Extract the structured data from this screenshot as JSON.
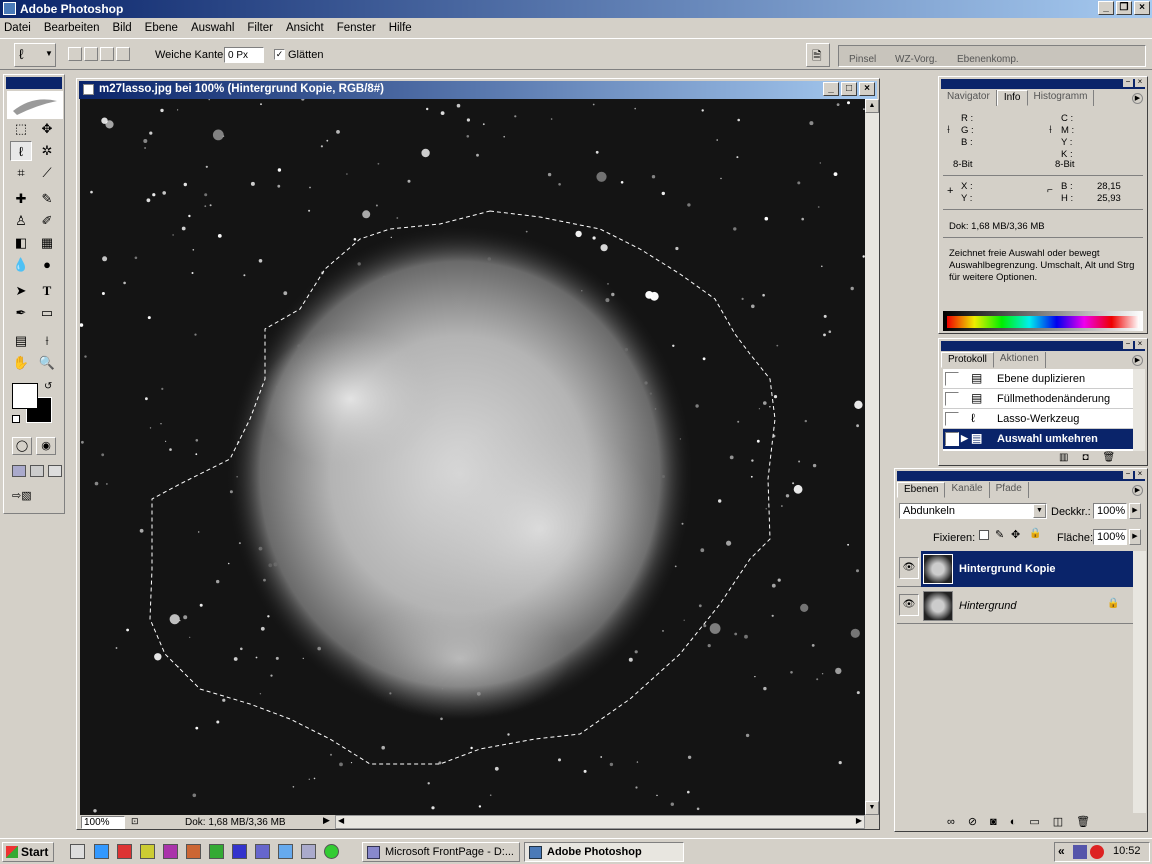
{
  "app": {
    "title": "Adobe Photoshop"
  },
  "menu": [
    "Datei",
    "Bearbeiten",
    "Bild",
    "Ebene",
    "Auswahl",
    "Filter",
    "Ansicht",
    "Fenster",
    "Hilfe"
  ],
  "options": {
    "feather_label": "Weiche Kante:",
    "feather_value": "0 Px",
    "antialias_label": "Glätten",
    "antialias_checked": true
  },
  "well_tabs": [
    "Pinsel",
    "WZ-Vorg.",
    "Ebenenkomp."
  ],
  "document": {
    "title": "m27lasso.jpg bei 100% (Hintergrund Kopie, RGB/8#)",
    "zoom": "100%",
    "doc_size": "Dok: 1,68 MB/3,36 MB"
  },
  "info_panel": {
    "tabs": [
      "Navigator",
      "Info",
      "Histogramm"
    ],
    "active_tab": "Info",
    "rgb_labels": [
      "R :",
      "G :",
      "B :"
    ],
    "cmyk_labels": [
      "C :",
      "M :",
      "Y :",
      "K :"
    ],
    "bit_left": "8-Bit",
    "bit_right": "8-Bit",
    "x_label": "X :",
    "y_label": "Y :",
    "b_label": "B :",
    "b_value": "28,15",
    "h_label": "H :",
    "h_value": "25,93",
    "doc": "Dok: 1,68 MB/3,36 MB",
    "hint": "Zeichnet freie Auswahl oder bewegt Auswahlbegrenzung. Umschalt, Alt und Strg für weitere Optionen."
  },
  "history_panel": {
    "tabs": [
      "Protokoll",
      "Aktionen"
    ],
    "items": [
      "Ebene duplizieren",
      "Füllmethodenänderung",
      "Lasso-Werkzeug",
      "Auswahl umkehren"
    ],
    "selected_index": 3
  },
  "layers_panel": {
    "tabs": [
      "Ebenen",
      "Kanäle",
      "Pfade"
    ],
    "blend_mode": "Abdunkeln",
    "opacity_label": "Deckkr.:",
    "opacity": "100%",
    "lock_label": "Fixieren:",
    "fill_label": "Fläche:",
    "fill": "100%",
    "layers": [
      {
        "name": "Hintergrund Kopie",
        "selected": true,
        "locked": false
      },
      {
        "name": "Hintergrund",
        "selected": false,
        "locked": true
      }
    ]
  },
  "taskbar": {
    "start": "Start",
    "tasks": [
      {
        "label": "Microsoft FrontPage - D:...",
        "active": false
      },
      {
        "label": "Adobe Photoshop",
        "active": true
      }
    ],
    "clock": "10:52"
  },
  "colors": {
    "titlebar": "#0a246a",
    "face": "#d4d0c8",
    "selection": "#0a246a"
  }
}
